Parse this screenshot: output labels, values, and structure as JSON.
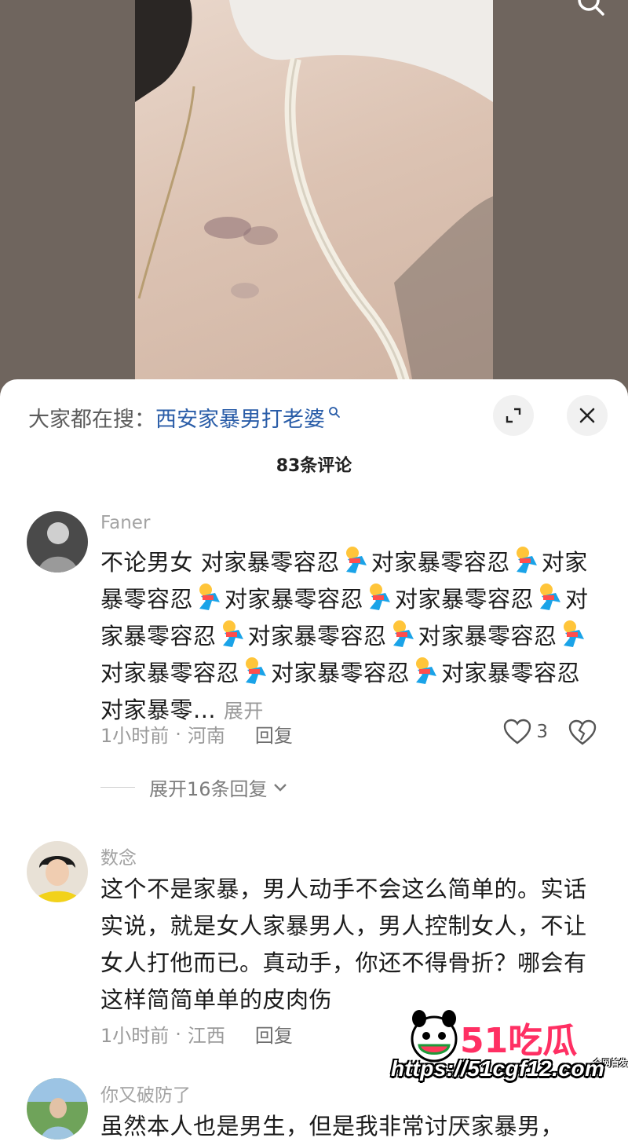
{
  "search_bar": {
    "prefix": "大家都在搜：",
    "term": "西安家暴男打老婆"
  },
  "comments_count": "83条评论",
  "comments": [
    {
      "username": "Faner",
      "text_segments": [
        "不论男女 对家暴零容忍",
        "对家暴零容忍",
        "对家暴零容忍",
        "对家暴零容忍",
        "对家暴零容忍",
        "对家暴零容忍",
        "对家暴零容忍",
        "对家暴零容忍",
        "对家暴零容忍",
        "对家暴零容忍",
        "对家暴零容忍对家暴零..."
      ],
      "expand_label": "展开",
      "time": "1小时前",
      "location": "河南",
      "reply_label": "回复",
      "likes": "3",
      "expand_replies_label": "展开16条回复"
    },
    {
      "username": "数念",
      "text": "这个不是家暴，男人动手不会这么简单的。实话实说，就是女人家暴男人，男人控制女人，不让女人打他而已。真动手，你还不得骨折？哪会有这样简简单单的皮肉伤",
      "time": "1小时前",
      "location": "江西",
      "reply_label": "回复"
    },
    {
      "username": "你又破防了",
      "text": "虽然本人也是男生，但是我非常讨厌家暴男，"
    }
  ],
  "watermark": {
    "title": "51吃瓜",
    "subtitle": "全网首发",
    "url": "https://51cgf12.com"
  }
}
